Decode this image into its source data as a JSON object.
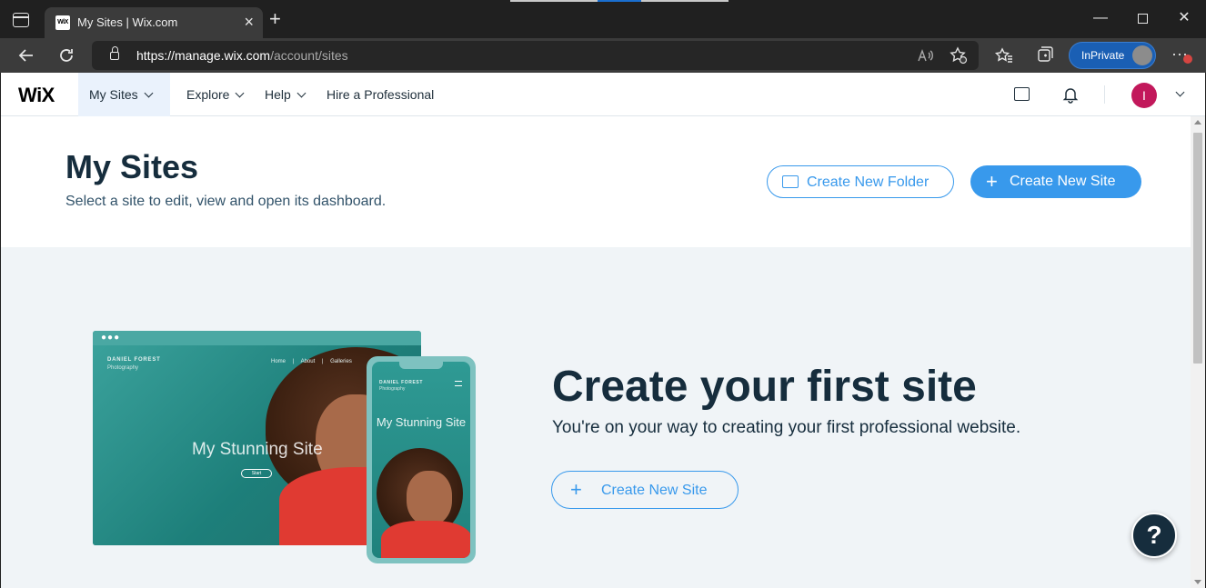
{
  "browser": {
    "tab_title": "My Sites | Wix.com",
    "tab_favicon": "WiX",
    "new_tab_glyph": "+",
    "close_glyph": "×",
    "url_host": "https://manage.wix.com",
    "url_path": "/account/sites",
    "inprivate_label": "InPrivate",
    "more_glyph": "···",
    "minimize_glyph": "—",
    "close_window_glyph": "✕"
  },
  "nav": {
    "logo": "WiX",
    "my_sites": "My Sites",
    "explore": "Explore",
    "help": "Help",
    "hire": "Hire a Professional",
    "avatar_initial": "I"
  },
  "header": {
    "title": "My Sites",
    "subtitle": "Select a site to edit, view and open its dashboard.",
    "create_folder": "Create New Folder",
    "create_site": "Create New Site"
  },
  "illustration": {
    "brand": "DANIEL FOREST",
    "brand_sub": "Photography",
    "menu": "Home  |  About  |  Galleries",
    "headline": "My Stunning Site",
    "phone_headline": "My Stunning Site",
    "button_label": "Start"
  },
  "cta": {
    "title": "Create your first site",
    "subtitle": "You're on your way to creating your first professional website.",
    "button": "Create New Site"
  },
  "help": {
    "glyph": "?"
  },
  "colors": {
    "accent": "#3899ec",
    "text_dark": "#162d3d",
    "avatar": "#c2185b"
  },
  "icons": [
    "sidebar-icon",
    "back-icon",
    "refresh-icon",
    "lock-icon",
    "read-aloud-icon",
    "add-favorite-icon",
    "favorites-icon",
    "collections-icon",
    "chat-icon",
    "bell-icon",
    "folder-plus-icon",
    "plus-icon",
    "help-icon"
  ]
}
